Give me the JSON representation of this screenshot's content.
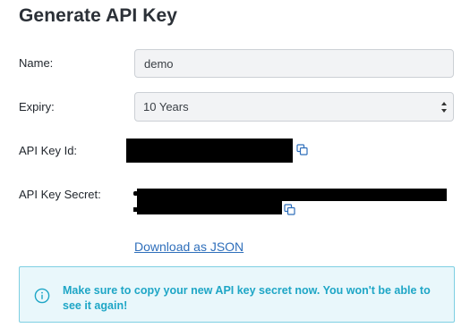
{
  "page": {
    "title": "Generate API Key"
  },
  "form": {
    "name_label": "Name:",
    "name_value": "demo",
    "expiry_label": "Expiry:",
    "expiry_value": "10 Years",
    "key_id_label": "API Key Id:",
    "key_secret_label": "API Key Secret:"
  },
  "actions": {
    "download_label": "Download as JSON"
  },
  "alert": {
    "message": "Make sure to copy your new API key secret now. You won't be able to see it again!"
  },
  "colors": {
    "link": "#2f6fbb",
    "alert_text": "#1ea6c6",
    "alert_bg": "#e9f7fb",
    "alert_border": "#7ecfe2"
  },
  "icons": {
    "copy": "copy-icon",
    "info": "info-icon",
    "select_arrows": "select-arrows-icon"
  }
}
